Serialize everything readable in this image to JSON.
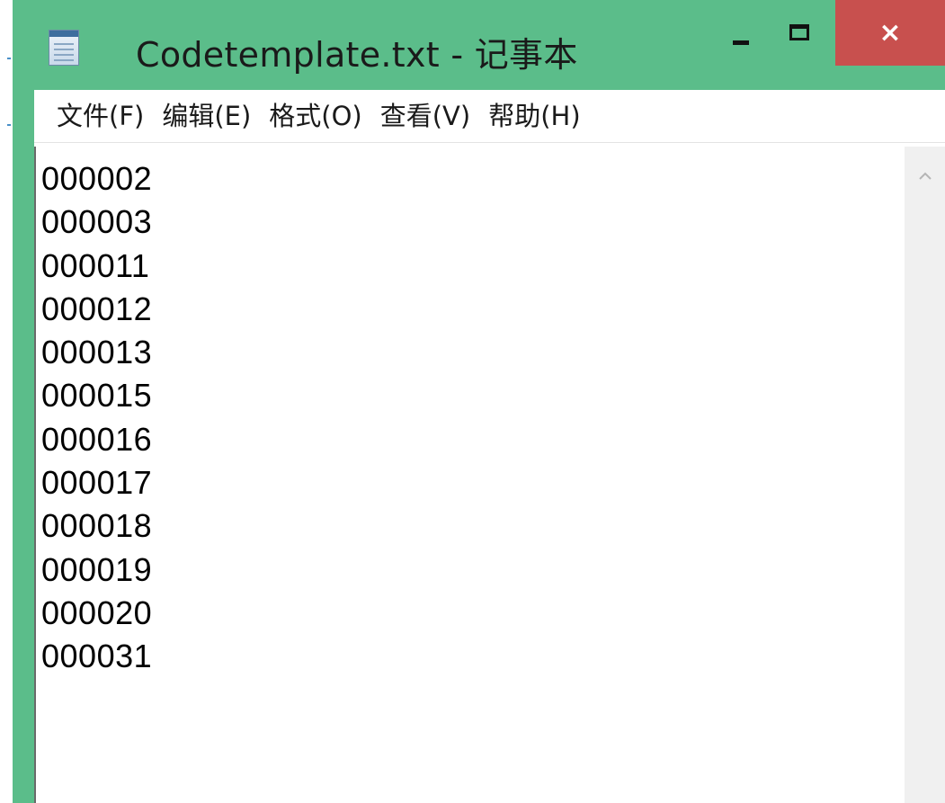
{
  "window": {
    "title": "Codetemplate.txt - 记事本",
    "icon": "notepad-icon",
    "controls": {
      "minimize": "minimize-icon",
      "maximize": "maximize-icon",
      "close": "×"
    }
  },
  "menu": {
    "items": [
      "文件(F)",
      "编辑(E)",
      "格式(O)",
      "查看(V)",
      "帮助(H)"
    ]
  },
  "editor": {
    "lines": [
      "000002",
      "000003",
      "000011",
      "000012",
      "000013",
      "000015",
      "000016",
      "000017",
      "000018",
      "000019",
      "000020",
      "000031"
    ]
  },
  "scrollbar": {
    "up_arrow": "chevron-up-icon"
  },
  "colors": {
    "titlebar": "#5bbd8a",
    "close_button": "#c8504e",
    "text": "#000000"
  }
}
